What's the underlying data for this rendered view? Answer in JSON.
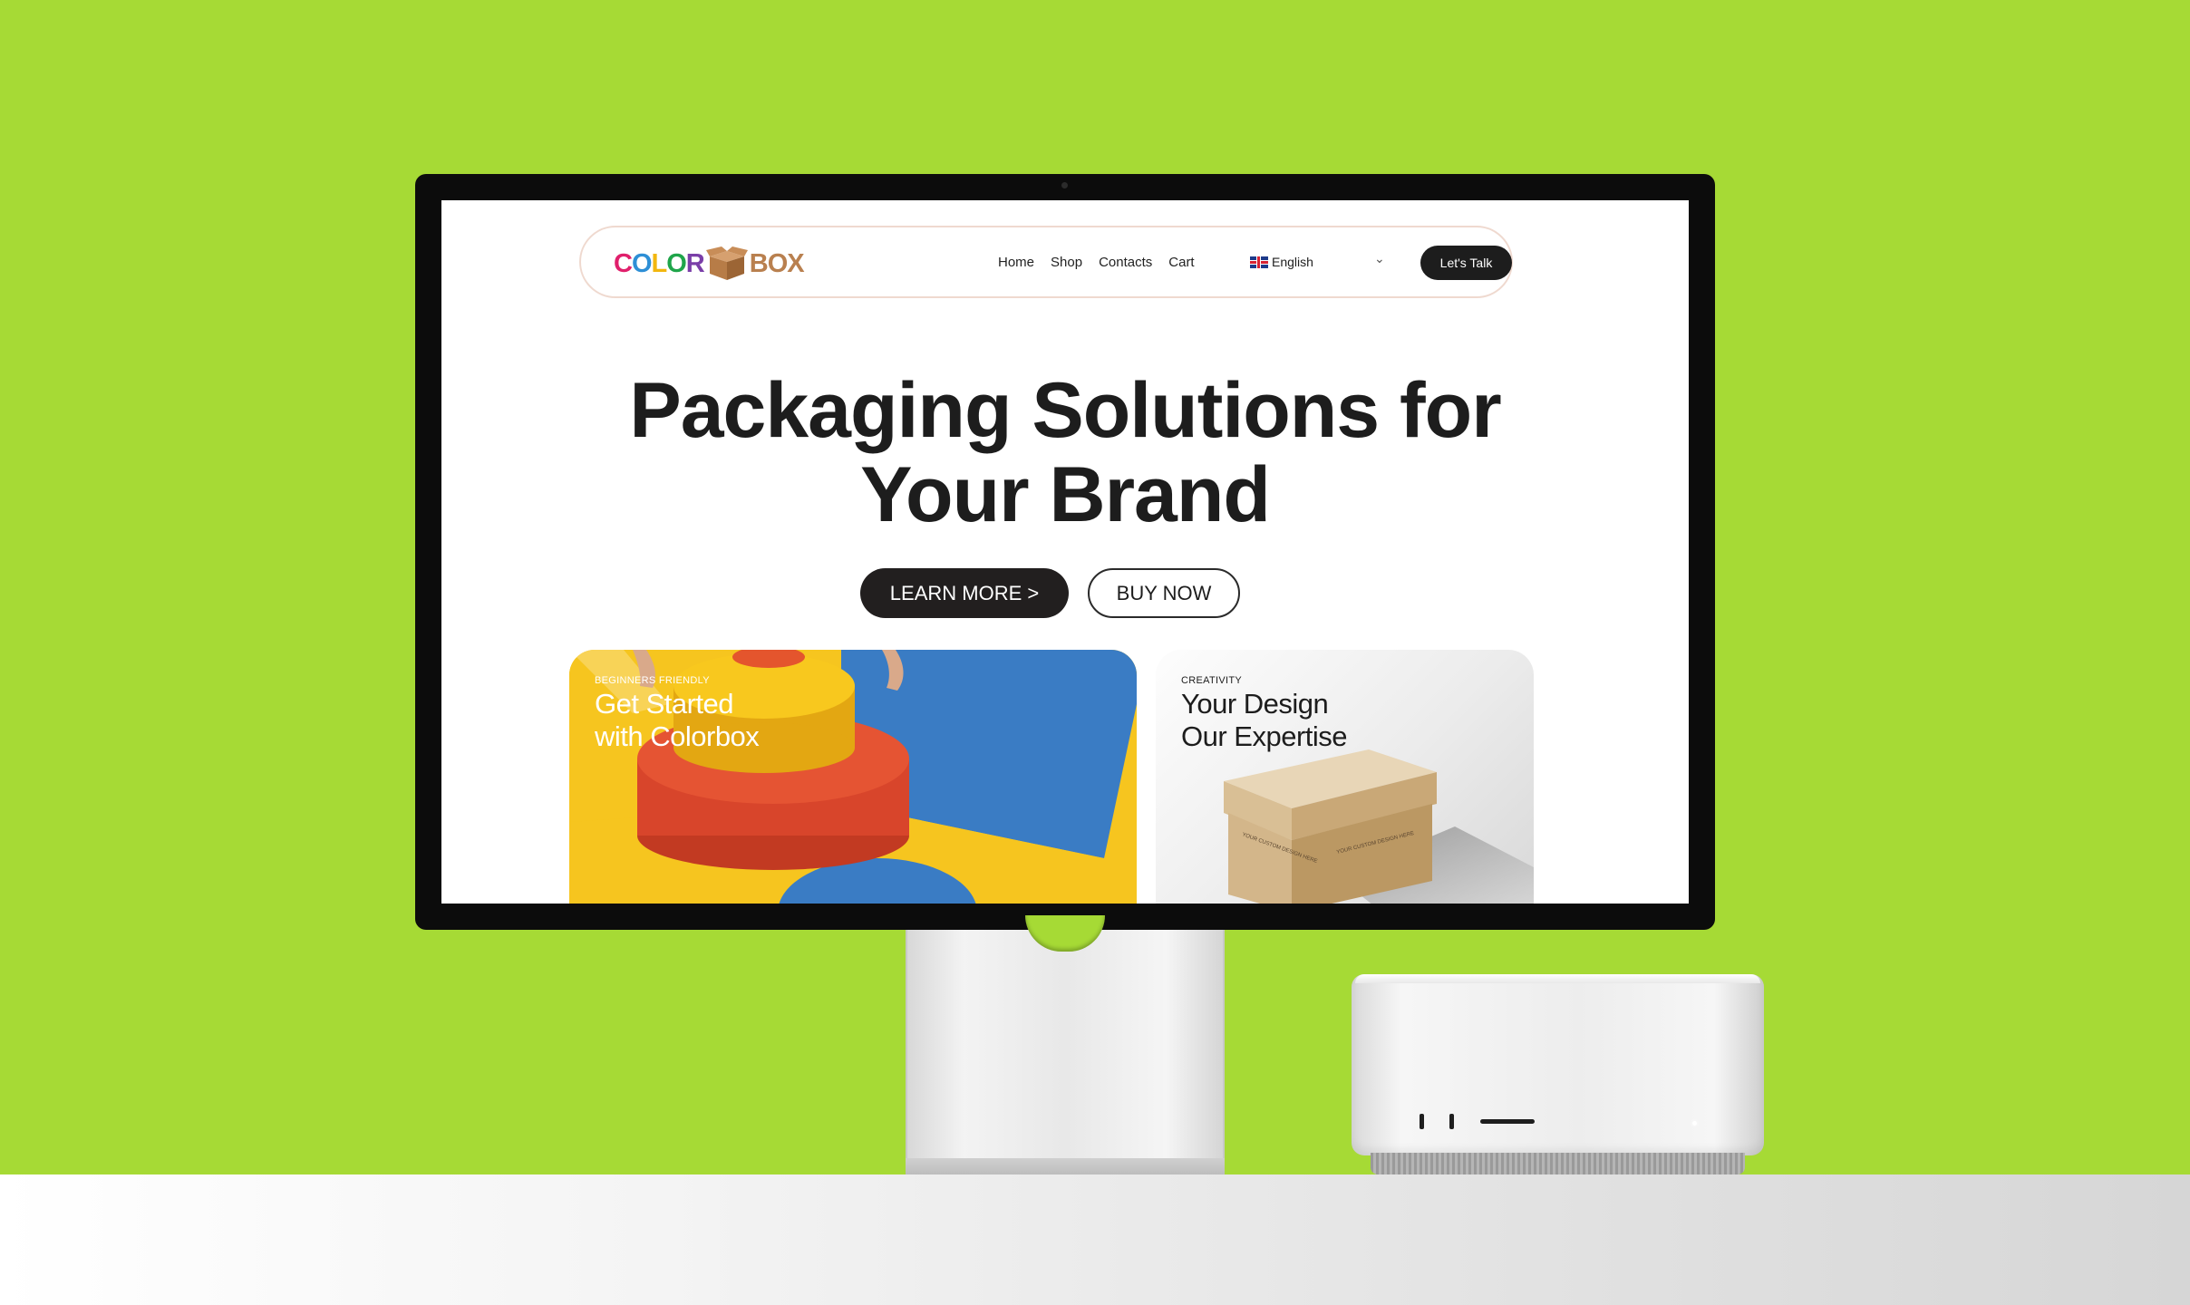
{
  "site": {
    "logo": {
      "color_word": "COLOR",
      "box_word": "BOX",
      "letters": [
        {
          "ch": "C",
          "color": "#e0206c"
        },
        {
          "ch": "O",
          "color": "#2e8fd6"
        },
        {
          "ch": "L",
          "color": "#f2b70f"
        },
        {
          "ch": "O",
          "color": "#1fa54a"
        },
        {
          "ch": "R",
          "color": "#7a3ea8"
        }
      ],
      "box_color": "#b9804f"
    },
    "nav": {
      "links": [
        "Home",
        "Shop",
        "Contacts",
        "Cart"
      ],
      "language": "English",
      "cta": "Let's Talk"
    },
    "hero": {
      "line1": "Packaging Solutions for",
      "line2": "Your Brand",
      "learn_more": "LEARN MORE >",
      "buy_now": "BUY NOW"
    },
    "cards": [
      {
        "tag": "BEGINNERS FRIENDLY",
        "title_line1": "Get Started",
        "title_line2": "with Colorbox"
      },
      {
        "tag": "CREATIVITY",
        "title_line1": "Your Design",
        "title_line2": "Our Expertise"
      }
    ]
  },
  "colors": {
    "background": "#a6da35",
    "dark_button": "#221f1f",
    "nav_border": "#efd9cf"
  },
  "icons": [
    "flag-uk-icon",
    "chevron-down-icon",
    "box-logo-icon",
    "camera-icon"
  ]
}
